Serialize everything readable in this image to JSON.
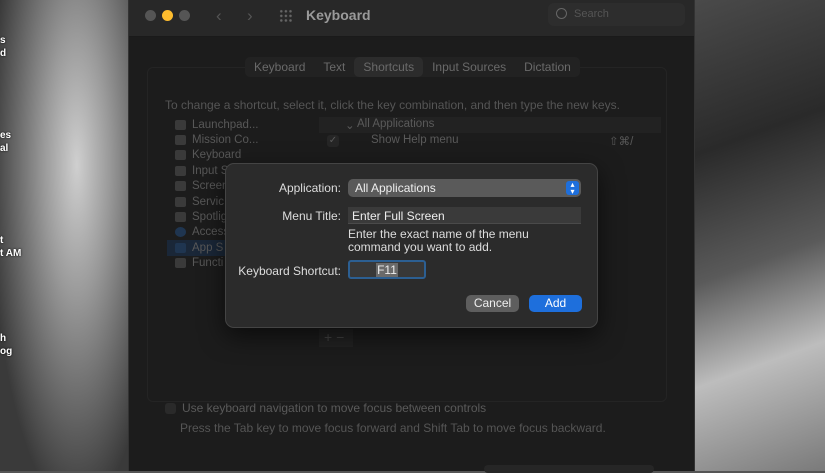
{
  "desktop": {
    "fragments": [
      "s",
      "d",
      "es",
      "al",
      "t",
      "t AM",
      "h",
      "og"
    ]
  },
  "window": {
    "title": "Keyboard",
    "search_placeholder": "Search",
    "back": "‹",
    "forward": "›",
    "tabs": [
      {
        "label": "Keyboard"
      },
      {
        "label": "Text"
      },
      {
        "label": "Shortcuts",
        "selected": true
      },
      {
        "label": "Input Sources"
      },
      {
        "label": "Dictation"
      }
    ],
    "hint": "To change a shortcut, select it, click the key combination, and then type the new keys.",
    "categories": [
      "Launchpad...",
      "Mission Co...",
      "Keyboard",
      "Input S",
      "Screen",
      "Servic",
      "Spotlig",
      "Access",
      "App S",
      "Functi"
    ],
    "list_header": "All Applications",
    "list_items": [
      {
        "label": "Show Help menu",
        "shortcut": "⇧⌘/",
        "checked": true
      }
    ],
    "plus": "+",
    "minus": "−",
    "kbnav_label": "Use keyboard navigation to move focus between controls",
    "kbnav_hint": "Press the Tab key to move focus forward and Shift Tab to move focus backward."
  },
  "dialog": {
    "application_label": "Application:",
    "application_value": "All Applications",
    "menu_title_label": "Menu Title:",
    "menu_title_value": "Enter Full Screen",
    "description": "Enter the exact name of the menu command you want to add.",
    "shortcut_label": "Keyboard Shortcut:",
    "shortcut_value": "F11",
    "cancel": "Cancel",
    "add": "Add"
  },
  "colors": {
    "accent": "#1e6fdc",
    "minimize": "#febc2e"
  }
}
